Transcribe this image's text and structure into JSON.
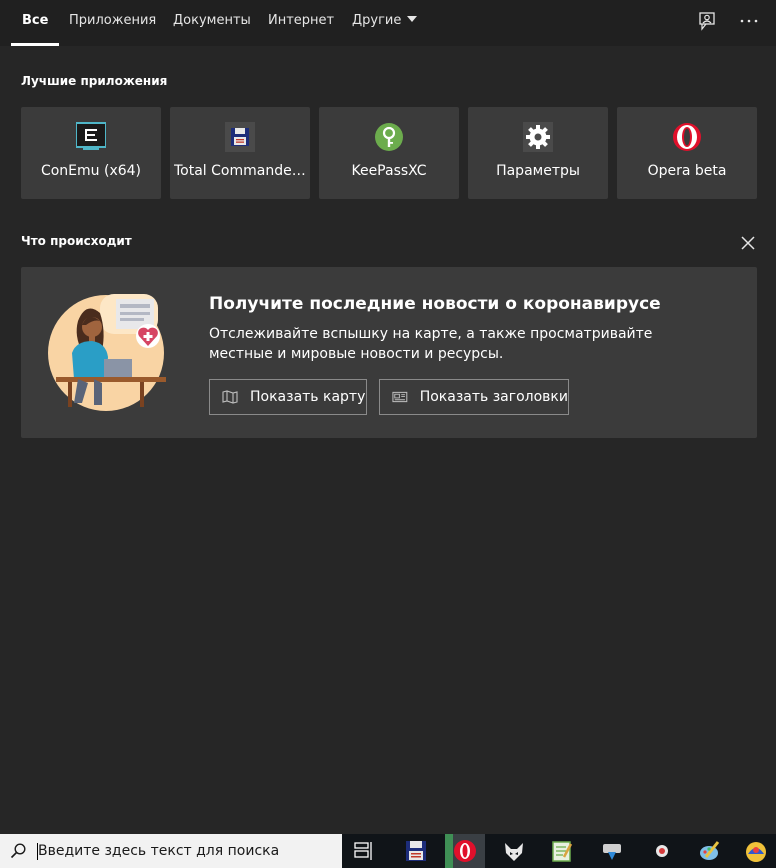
{
  "nav": {
    "tabs": [
      {
        "label": "Все",
        "active": true
      },
      {
        "label": "Приложения"
      },
      {
        "label": "Документы"
      },
      {
        "label": "Интернет"
      },
      {
        "label": "Другие"
      }
    ],
    "icons": [
      "feedback-icon",
      "more-icon"
    ]
  },
  "top_apps": {
    "title": "Лучшие приложения",
    "items": [
      {
        "label": "ConEmu (x64)",
        "icon": "conemu-icon"
      },
      {
        "label": "Total Commander...",
        "icon": "total-commander-icon"
      },
      {
        "label": "KeePassXC",
        "icon": "keepassxc-icon"
      },
      {
        "label": "Параметры",
        "icon": "gear-icon"
      },
      {
        "label": "Opera beta",
        "icon": "opera-icon"
      }
    ]
  },
  "whats_new": {
    "title": "Что происходит",
    "card": {
      "title": "Получите последние новости о коронавирусе",
      "description": "Отслеживайте вспышку на карте, а также просматривайте местные и мировые новости и ресурсы.",
      "buttons": [
        {
          "label": "Показать карту",
          "icon": "map-icon"
        },
        {
          "label": "Показать заголовки",
          "icon": "news-icon"
        }
      ]
    }
  },
  "taskbar": {
    "search_placeholder": "Введите здесь текст для поиска",
    "icons": [
      "task-view-icon",
      "total-commander-icon",
      "opera-icon",
      "foobar-icon",
      "notepad-icon",
      "download-icon",
      "chrome-icon",
      "paint-icon",
      "app-icon"
    ]
  },
  "colors": {
    "background": "#262626",
    "tile": "#3b3b3b",
    "topbar": "#202020",
    "taskbar": "#101418"
  }
}
